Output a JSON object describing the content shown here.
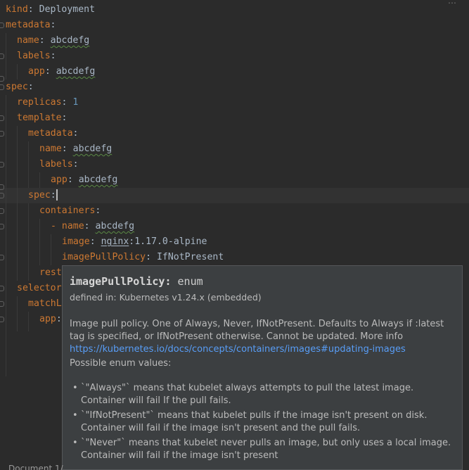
{
  "editor": {
    "lines": [
      {
        "indent": 0,
        "key": "kind",
        "value": "Deployment"
      },
      {
        "indent": 0,
        "key": "metadata",
        "value": ""
      },
      {
        "indent": 1,
        "key": "name",
        "value": "abcdefg"
      },
      {
        "indent": 1,
        "key": "labels",
        "value": ""
      },
      {
        "indent": 2,
        "key": "app",
        "value": "abcdefg"
      },
      {
        "indent": 0,
        "key": "spec",
        "value": ""
      },
      {
        "indent": 1,
        "key": "replicas",
        "value": "1"
      },
      {
        "indent": 1,
        "key": "template",
        "value": ""
      },
      {
        "indent": 2,
        "key": "metadata",
        "value": ""
      },
      {
        "indent": 3,
        "key": "name",
        "value": "abcdefg"
      },
      {
        "indent": 3,
        "key": "labels",
        "value": ""
      },
      {
        "indent": 4,
        "key": "app",
        "value": "abcdefg"
      },
      {
        "indent": 2,
        "key": "spec",
        "value": ""
      },
      {
        "indent": 3,
        "key": "containers",
        "value": ""
      },
      {
        "indent": 4,
        "key": "- name",
        "value": "abcdefg"
      },
      {
        "indent": 5,
        "key": "image",
        "value": "nginx:1.17.0-alpine"
      },
      {
        "indent": 5,
        "key": "imagePullPolicy",
        "value": "IfNotPresent"
      },
      {
        "indent": 3,
        "key": "rest",
        "value": ""
      },
      {
        "indent": 1,
        "key": "selector",
        "value": ""
      },
      {
        "indent": 2,
        "key": "matchL",
        "value": ""
      },
      {
        "indent": 3,
        "key": "app",
        "value": ""
      }
    ]
  },
  "tooltip": {
    "property": "imagePullPolicy:",
    "type": "enum",
    "defined_in": "defined in: Kubernetes v1.24.x (embedded)",
    "description": "Image pull policy. One of Always, Never, IfNotPresent. Defaults to Always if :latest tag is specified, or IfNotPresent otherwise. Cannot be updated. More info",
    "link": "https://kubernetes.io/docs/concepts/containers/images#updating-images",
    "enum_title": "Possible enum values:",
    "enum_values": [
      "`\"Always\"` means that kubelet always attempts to pull the latest image. Container will fail If the pull fails.",
      "`\"IfNotPresent\"` means that kubelet pulls if the image isn't present on disk. Container will fail if the image isn't present and the pull fails.",
      "`\"Never\"` means that kubelet never pulls an image, but only uses a local image. Container will fail if the image isn't present"
    ]
  },
  "status_bar": {
    "document": "Document 1/"
  }
}
